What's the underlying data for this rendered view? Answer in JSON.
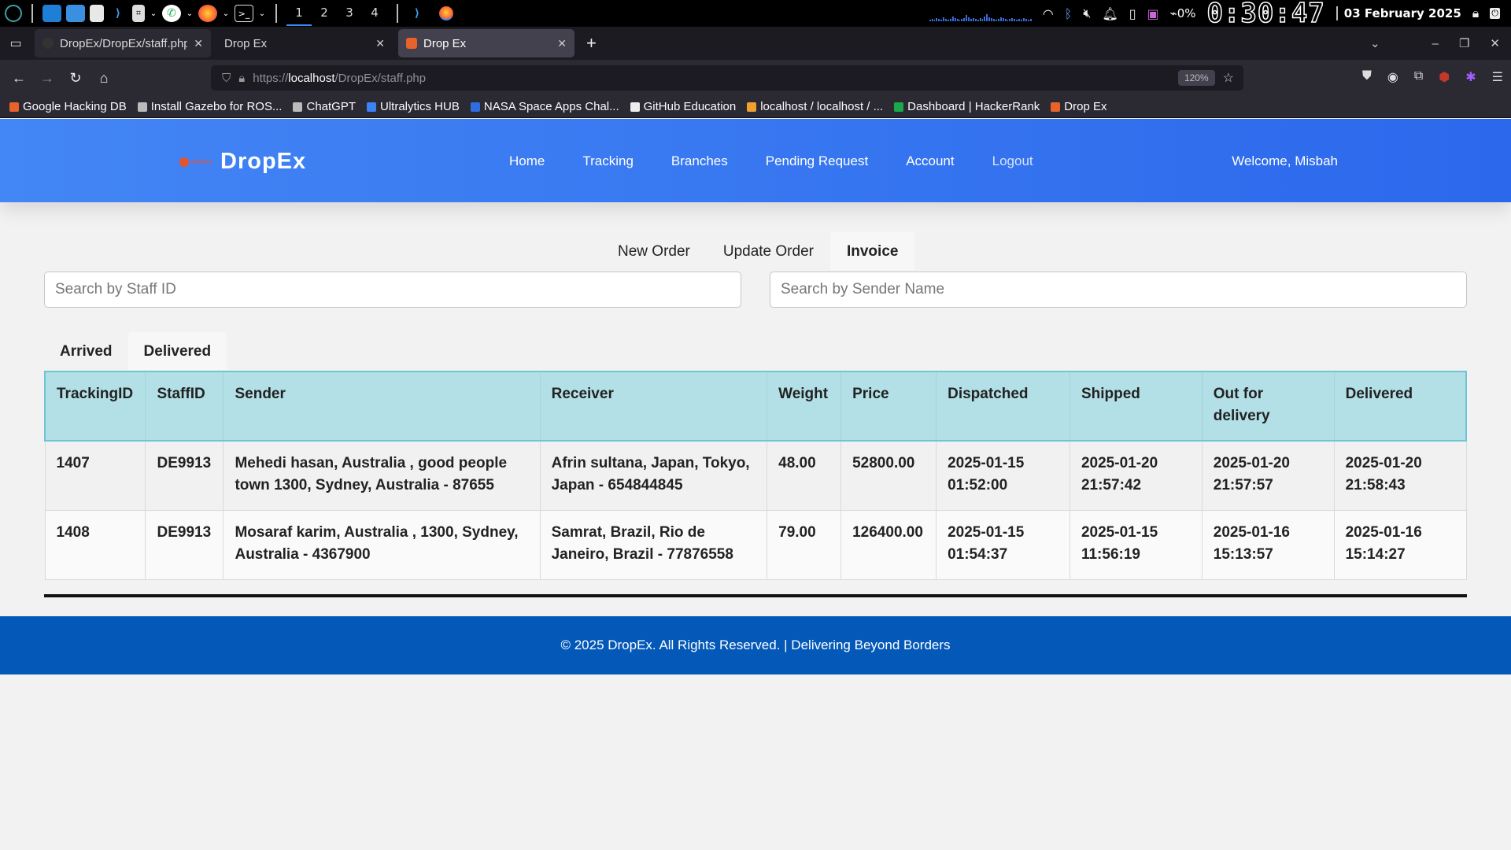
{
  "taskbar": {
    "workspaces": [
      "1",
      "2",
      "3",
      "4"
    ],
    "battery": "0%",
    "clock": "0:30:47",
    "date": "03 February 2025",
    "icons": [
      "app-launcher-icon",
      "desktop-icon",
      "files-icon",
      "text-editor-icon",
      "vscode-icon",
      "terminal-app-icon",
      "whatsapp-icon",
      "firefox-icon",
      "terminal-icon",
      "wifi-icon",
      "bluetooth-icon",
      "mute-icon",
      "bell-icon",
      "clipboard-icon",
      "screenshot-icon",
      "battery-icon",
      "lock-icon"
    ]
  },
  "browser": {
    "tabs": [
      {
        "title": "DropEx/DropEx/staff.php",
        "favicon_color": "#333333"
      },
      {
        "title": "Drop Ex",
        "favicon_color": ""
      },
      {
        "title": "Drop Ex",
        "favicon_color": "#e8622b"
      }
    ],
    "url_prefix": "https://",
    "url_host": "localhost",
    "url_path": "/DropEx/staff.php",
    "zoom": "120%",
    "bookmarks": [
      {
        "label": "Google Hacking DB",
        "color": "#e8622b"
      },
      {
        "label": "Install Gazebo for ROS...",
        "color": "#bbbbbb"
      },
      {
        "label": "ChatGPT",
        "color": "#bbbbbb"
      },
      {
        "label": "Ultralytics HUB",
        "color": "#3b82f6"
      },
      {
        "label": "NASA Space Apps Chal...",
        "color": "#2f6de0"
      },
      {
        "label": "GitHub Education",
        "color": "#eeeeee"
      },
      {
        "label": "localhost / localhost / ...",
        "color": "#f0a030"
      },
      {
        "label": "Dashboard | HackerRank",
        "color": "#1ba94c"
      },
      {
        "label": "Drop Ex",
        "color": "#e8622b"
      }
    ]
  },
  "site": {
    "brand": "DropEx",
    "logo_text": "delivery",
    "nav": [
      "Home",
      "Tracking",
      "Branches",
      "Pending Request",
      "Account",
      "Logout"
    ],
    "welcome": "Welcome, Misbah",
    "sub_tabs": [
      "New Order",
      "Update Order",
      "Invoice"
    ],
    "active_sub_tab": "Invoice",
    "search_staff_placeholder": "Search by Staff ID",
    "search_sender_placeholder": "Search by Sender Name",
    "status_tabs": [
      "Arrived",
      "Delivered"
    ],
    "active_status_tab": "Delivered",
    "table": {
      "headers": [
        "TrackingID",
        "StaffID",
        "Sender",
        "Receiver",
        "Weight",
        "Price",
        "Dispatched",
        "Shipped",
        "Out for delivery",
        "Delivered"
      ],
      "rows": [
        [
          "1407",
          "DE9913",
          "Mehedi hasan, Australia , good people town 1300, Sydney, Australia - 87655",
          "Afrin sultana, Japan, Tokyo, Japan - 654844845",
          "48.00",
          "52800.00",
          "2025-01-15 01:52:00",
          "2025-01-20 21:57:42",
          "2025-01-20 21:57:57",
          "2025-01-20 21:58:43"
        ],
        [
          "1408",
          "DE9913",
          "Mosaraf karim, Australia , 1300, Sydney, Australia - 4367900",
          "Samrat, Brazil, Rio de Janeiro, Brazil - 77876558",
          "79.00",
          "126400.00",
          "2025-01-15 01:54:37",
          "2025-01-15 11:56:19",
          "2025-01-16 15:13:57",
          "2025-01-16 15:14:27"
        ]
      ]
    },
    "footer": "© 2025 DropEx. All Rights Reserved. | Delivering Beyond Borders"
  },
  "colors": {
    "header_start": "#4386f5",
    "header_end": "#2c68ec",
    "table_header": "#b2e0e6",
    "footer": "#0358b8"
  }
}
